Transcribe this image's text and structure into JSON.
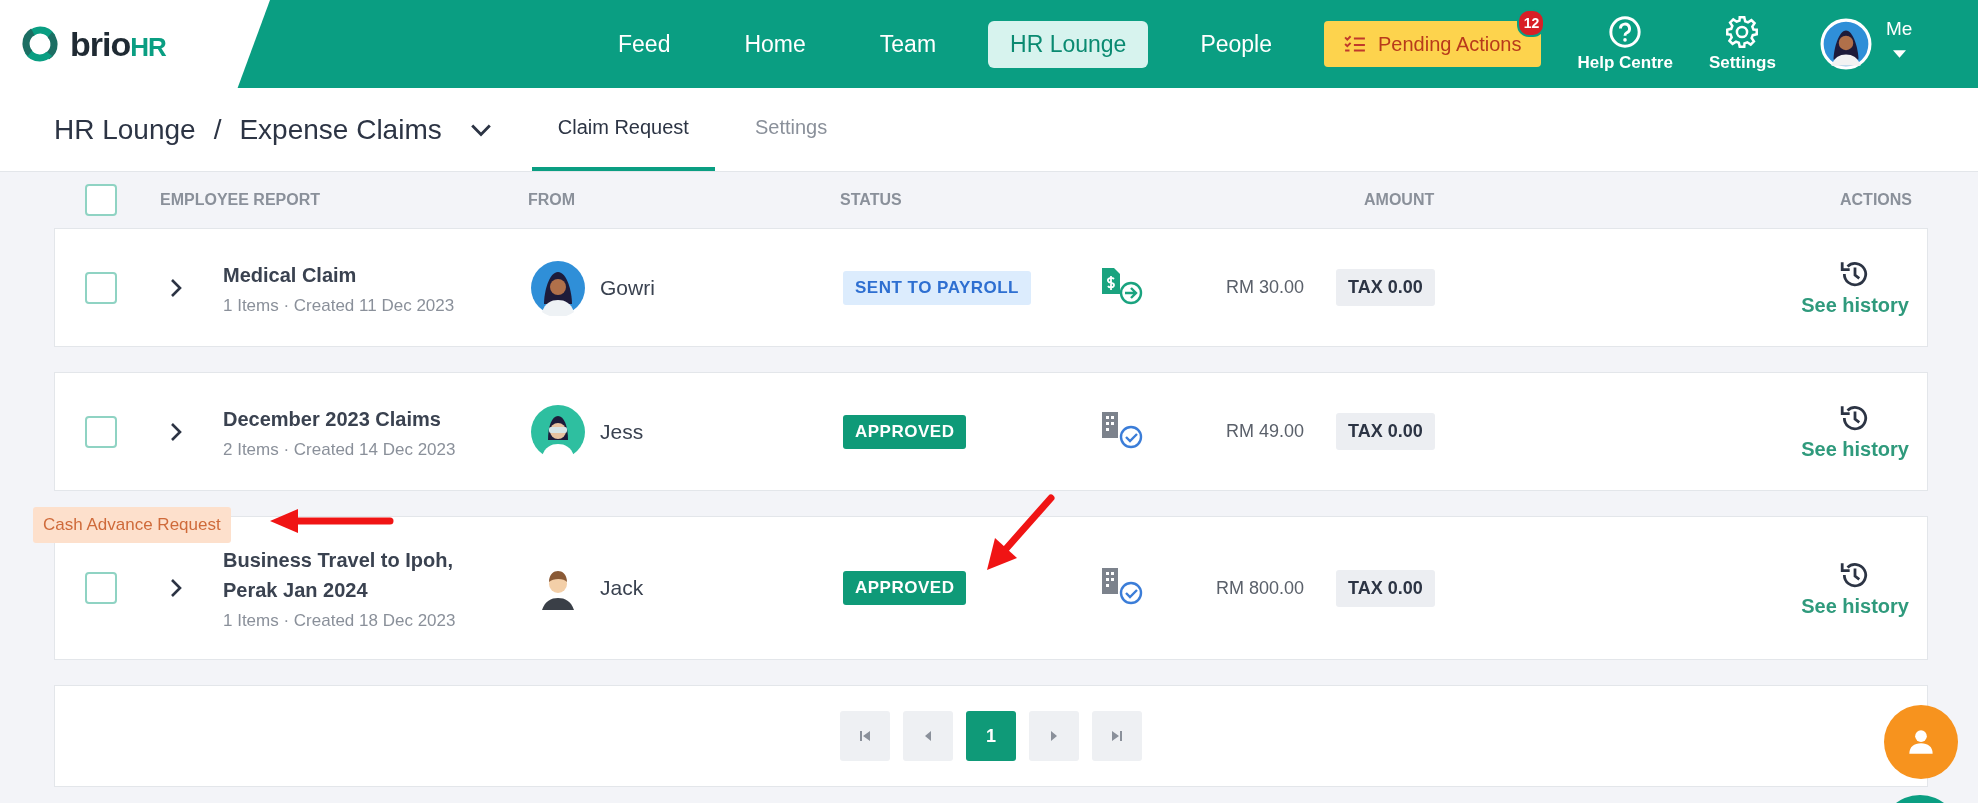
{
  "brand": {
    "name": "brio",
    "suffix": "HR"
  },
  "nav": [
    {
      "label": "Feed",
      "selected": false
    },
    {
      "label": "Home",
      "selected": false
    },
    {
      "label": "Team",
      "selected": false
    },
    {
      "label": "HR Lounge",
      "selected": true
    },
    {
      "label": "People",
      "selected": false
    }
  ],
  "pending": {
    "label": "Pending Actions",
    "count": "12"
  },
  "utilities": [
    {
      "label": "Help Centre",
      "kind": "help"
    },
    {
      "label": "Settings",
      "kind": "settings"
    }
  ],
  "user": {
    "label": "Me"
  },
  "breadcrumb": {
    "parent": "HR Lounge",
    "separator": "/",
    "current": "Expense Claims"
  },
  "tabs": [
    {
      "label": "Claim Request",
      "selected": true
    },
    {
      "label": "Settings",
      "selected": false
    }
  ],
  "table": {
    "checked": false,
    "columns": [
      "EMPLOYEE REPORT",
      "FROM",
      "STATUS",
      "AMOUNT",
      "ACTIONS"
    ],
    "rows": [
      {
        "checked": false,
        "title": "Medical Claim",
        "meta": "1 Items · Created 11 Dec 2023",
        "from": "Gowri",
        "avatar": {
          "kind": "woman"
        },
        "status": {
          "label": "SENT TO PAYROLL",
          "kind": "payroll"
        },
        "state_icon": {
          "kind": "payroll"
        },
        "amount": "RM 30.00",
        "tax": "TAX 0.00",
        "action": "See history"
      },
      {
        "checked": false,
        "title": "December 2023 Claims",
        "meta": "2 Items · Created 14 Dec 2023",
        "from": "Jess",
        "avatar": {
          "kind": "woman-glasses"
        },
        "status": {
          "label": "APPROVED",
          "kind": "approved"
        },
        "state_icon": {
          "kind": "company-approved"
        },
        "amount": "RM 49.00",
        "tax": "TAX 0.00",
        "action": "See history"
      },
      {
        "checked": false,
        "tag": "Cash Advance Request",
        "title": "Business Travel to Ipoh, Perak Jan 2024",
        "meta": "1 Items · Created 18 Dec 2023",
        "from": "Jack",
        "avatar": {
          "kind": "man"
        },
        "status": {
          "label": "APPROVED",
          "kind": "approved"
        },
        "state_icon": {
          "kind": "company-approved"
        },
        "amount": "RM 800.00",
        "tax": "TAX 0.00",
        "action": "See history"
      }
    ]
  },
  "pagination": {
    "pages": [
      {
        "label": "1",
        "selected": true
      }
    ]
  }
}
